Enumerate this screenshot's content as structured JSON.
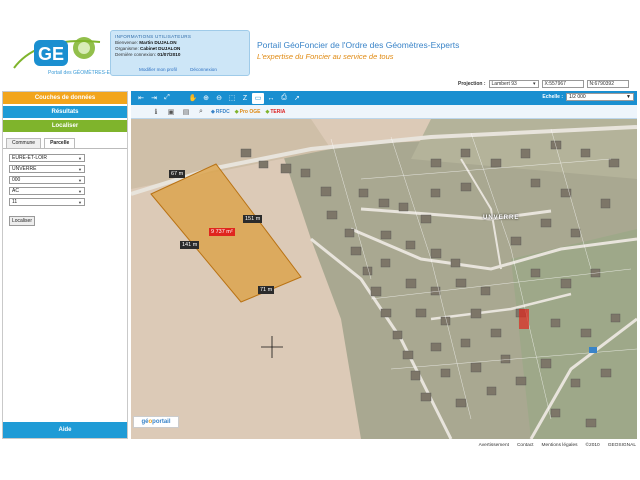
{
  "header": {
    "logo_text": "Portail des GÉOMÈTRES-EXPERTS",
    "portal_title": "Portail GéoFoncier de l'Ordre des Géomètres-Experts",
    "portal_subtitle": "L'expertise du Foncier au service de tous"
  },
  "user_info": {
    "title": "INFORMATIONS UTILISATEURS",
    "welcome_label": "Bienvenue:",
    "welcome_value": "Martin DUJALON",
    "org_label": "Organisme:",
    "org_value": "Cabinet DUJALON",
    "last_conn_label": "Dernière connexion:",
    "last_conn_value": "01/07/2010",
    "modify_link": "Modifier mon profil",
    "logout_link": "Déconnexion"
  },
  "projection": {
    "label": "Projection :",
    "value": "Lambert 93",
    "x": "X:557967",
    "y": "N:6790392"
  },
  "left_panel": {
    "couches": "Couches de données",
    "resultats": "Résultats",
    "localiser": "Localiser",
    "tab_commune": "Commune",
    "tab_parcelle": "Parcelle",
    "fields": [
      "EURE-ET-LOIR",
      "UNVERRE",
      "000",
      "AC",
      "11"
    ],
    "locate_button": "Localiser",
    "aide": "Aide"
  },
  "toolbar": {
    "echelle_label": "Echelle :",
    "echelle_value": "1/2 000",
    "layer_rfdc": "RFDC",
    "layer_pro": "Pro OGE",
    "layer_teria": "TERIA"
  },
  "map": {
    "label_67": "67 m",
    "label_151": "151 m",
    "label_141": "141 m",
    "label_71": "71 m",
    "label_area": "9 737 m²",
    "ville": "UNVERRE",
    "geoportail": "portail"
  },
  "footer": {
    "links": [
      "Avertissement",
      "Contact",
      "Mentions légales",
      "©2010",
      "GEOSIGNAL"
    ]
  }
}
